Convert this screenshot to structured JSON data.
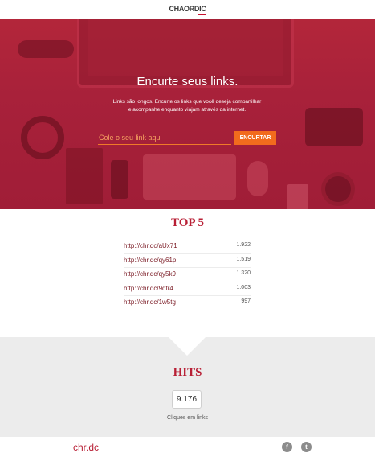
{
  "header": {
    "logo_text": "CHAORDIC"
  },
  "hero": {
    "title": "Encurte seus links.",
    "subtitle_line1": "Links são longos. Encurte os links que você deseja compartilhar",
    "subtitle_line2": "e acompanhe enquanto viajam através da internet.",
    "input_placeholder": "Cole o seu link aqui",
    "shorten_button": "ENCURTAR"
  },
  "top5": {
    "title": "TOP 5",
    "items": [
      {
        "url": "http://chr.dc/aUx71",
        "clicks": "1.922"
      },
      {
        "url": "http://chr.dc/qy61p",
        "clicks": "1.519"
      },
      {
        "url": "http://chr.dc/qy5k9",
        "clicks": "1.320"
      },
      {
        "url": "http://chr.dc/9dtr4",
        "clicks": "1.003"
      },
      {
        "url": "http://chr.dc/1w5tg",
        "clicks": "997"
      }
    ]
  },
  "hits": {
    "title": "HITS",
    "total": "9.176",
    "caption": "Cliques em links"
  },
  "footer": {
    "brand": "chr.dc",
    "social": [
      {
        "icon": "facebook-icon",
        "glyph": "f"
      },
      {
        "icon": "twitter-icon",
        "glyph": "t"
      }
    ]
  },
  "colors": {
    "brand_red": "#b81f35",
    "hero_red": "#a8213a",
    "accent_orange": "#f26b1d",
    "hits_bg": "#ececec"
  }
}
